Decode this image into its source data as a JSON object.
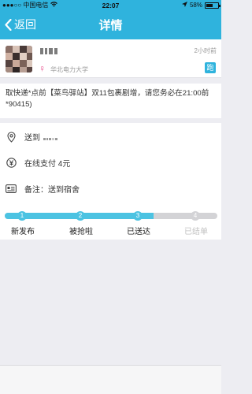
{
  "status_bar": {
    "carrier": "●●●○○ 中国电信",
    "time": "22:07",
    "battery": "58%",
    "battery_level": 0.58
  },
  "nav": {
    "back_label": "返回",
    "title": "详情"
  },
  "user": {
    "school": "华北电力大学",
    "gender_symbol": "♀",
    "time_ago": "2小时前",
    "badge": "跑"
  },
  "task": {
    "description": "取快递*点前【菜鸟驿站】双11包裹剧增，请您务必在21:00前*90415)"
  },
  "details": {
    "deliver_to": "送到",
    "payment": "在线支付 4元",
    "note": "备注：送到宿舍"
  },
  "progress": {
    "current_step": 3,
    "steps": [
      {
        "num": "1",
        "label": "新发布"
      },
      {
        "num": "2",
        "label": "被抢啦"
      },
      {
        "num": "3",
        "label": "已送达"
      },
      {
        "num": "4",
        "label": "已结单"
      }
    ]
  },
  "colors": {
    "primary": "#2fb3dd",
    "progress_active": "#4cc3e2",
    "progress_inactive": "#d3d3d6",
    "female_pink": "#e84b8a"
  },
  "icons": [
    "back-chevron-icon",
    "wifi-icon",
    "location-arrow-icon",
    "map-pin-icon",
    "yen-circle-icon",
    "note-card-icon",
    "female-icon"
  ]
}
